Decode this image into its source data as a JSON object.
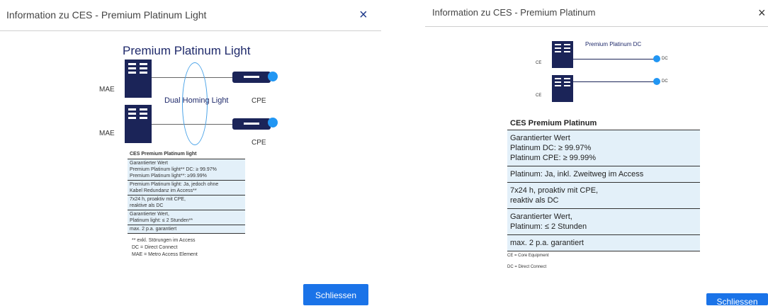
{
  "left_dialog": {
    "title": "Information zu CES - Premium Platinum Light",
    "close_icon": "×",
    "diagram": {
      "heading": "Premium Platinum Light",
      "mae_label_1": "MAE",
      "mae_label_2": "MAE",
      "cpe_label_1": "CPE",
      "cpe_label_2": "CPE",
      "homing_label": "Dual Homing Light"
    },
    "table": {
      "header": "CES Premium Platinum light",
      "rows": [
        "Garantierter Wert\nPremium Platinum light** DC: ≥ 99.97%\nPremium Platinum light**: ≥99.99%",
        "Premium Platinum light: Ja, jedoch ohne\nKabel Redundanz im Access**",
        "7x24 h, proaktiv mit CPE,\nreaktive als DC",
        "Garantierter Wert,\nPlatinum light: ≤ 2 Stunden**",
        "max. 2 p.a. garantiert"
      ]
    },
    "footnotes": [
      "** exkl. Störungen im Access",
      "DC = Direct Connect",
      "MAE = Metro Access Element"
    ],
    "button_label": "Schliessen"
  },
  "right_dialog": {
    "title": "Information zu CES - Premium Platinum",
    "close_icon": "×",
    "diagram": {
      "heading": "Premium Platinum DC",
      "ce_label_1": "CE",
      "ce_label_2": "CE",
      "dc_label_1": "DC",
      "dc_label_2": "DC"
    },
    "table": {
      "header": "CES Premium Platinum",
      "rows": [
        "Garantierter Wert\nPlatinum DC: ≥ 99.97%\nPlatinum CPE: ≥ 99.99%",
        "Platinum: Ja, inkl. Zweitweg im Access",
        "7x24 h, proaktiv mit CPE,\nreaktiv als DC",
        "Garantierter Wert,\nPlatinum: ≤ 2 Stunden",
        "max. 2 p.a. garantiert"
      ]
    },
    "footnotes": [
      "CE = Core Equipment",
      "DC = Direct Connect"
    ],
    "button_label": "Schliessen"
  },
  "colors": {
    "accent": "#1a73e8",
    "navy": "#1b2458",
    "table_fill": "#e3f0f9",
    "dot": "#2196f3"
  }
}
